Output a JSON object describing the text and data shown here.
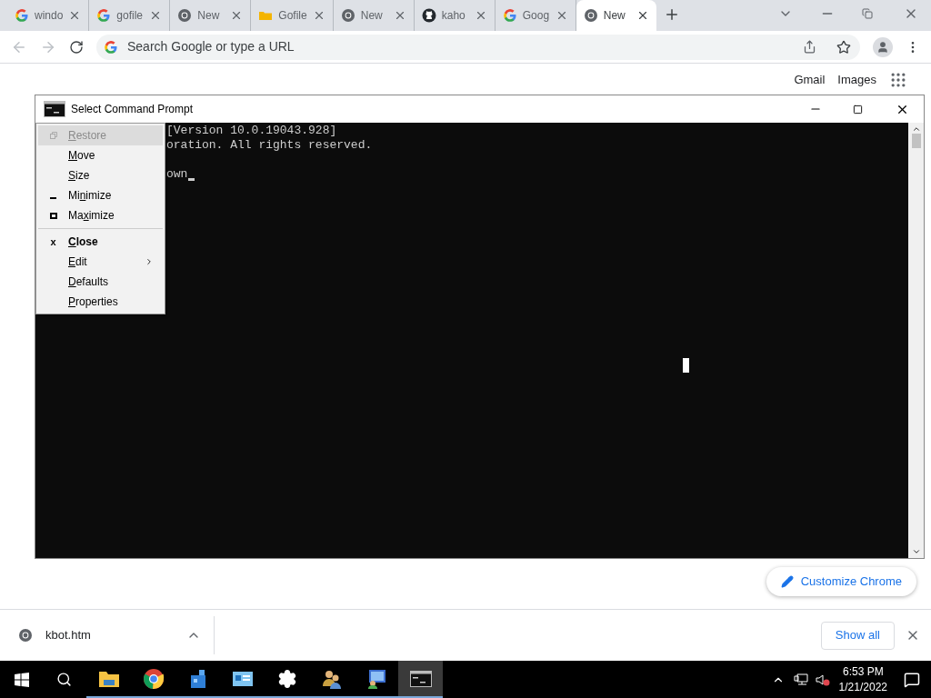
{
  "tabs": [
    {
      "title": "windo",
      "kind": "google",
      "selected": false
    },
    {
      "title": "gofile",
      "kind": "google",
      "selected": false
    },
    {
      "title": "New",
      "kind": "chrome",
      "selected": false
    },
    {
      "title": "Gofile",
      "kind": "folder",
      "selected": false
    },
    {
      "title": "New",
      "kind": "chrome",
      "selected": false
    },
    {
      "title": "kaho",
      "kind": "github",
      "selected": false
    },
    {
      "title": "Goog",
      "kind": "google",
      "selected": false
    },
    {
      "title": "New",
      "kind": "chrome",
      "selected": true
    }
  ],
  "omnibox": {
    "placeholder": "Search Google or type a URL"
  },
  "page_links": [
    "Gmail",
    "Images"
  ],
  "customize_button": "Customize Chrome",
  "console_window": {
    "title": "Select Command Prompt",
    "lines": [
      "[Version 10.0.19043.928]",
      "oration. All rights reserved."
    ],
    "prompt": "own",
    "menu": [
      {
        "hotkey": "R",
        "after": "estore",
        "kind": "restore",
        "disabled": true,
        "selected": true
      },
      {
        "hotkey": "M",
        "after": "ove",
        "kind": "plain",
        "disabled": false,
        "selected": false
      },
      {
        "hotkey": "S",
        "after": "ize",
        "kind": "plain",
        "disabled": false,
        "selected": false
      },
      {
        "before": "Mi",
        "hotkey": "n",
        "after": "imize",
        "kind": "minimize",
        "disabled": false,
        "selected": false
      },
      {
        "before": "Ma",
        "hotkey": "x",
        "after": "imize",
        "kind": "maximize",
        "disabled": false,
        "selected": false
      },
      {
        "hotkey": "C",
        "after": "lose",
        "kind": "default",
        "mark": "x",
        "disabled": false,
        "selected": false
      },
      {
        "hotkey": "E",
        "after": "dit",
        "kind": "submenu",
        "disabled": false,
        "selected": false
      },
      {
        "hotkey": "D",
        "after": "efaults",
        "kind": "plain",
        "disabled": false,
        "selected": false
      },
      {
        "hotkey": "P",
        "after": "roperties",
        "kind": "plain",
        "disabled": false,
        "selected": false
      }
    ]
  },
  "download_bar": {
    "file": "kbot.htm",
    "show_all": "Show all"
  },
  "taskbar": {
    "apps": [
      {
        "kind": "folder",
        "selected": false
      },
      {
        "kind": "chrome",
        "selected": false
      },
      {
        "kind": "cube",
        "selected": false
      },
      {
        "kind": "card",
        "selected": false
      },
      {
        "kind": "gear",
        "selected": false
      },
      {
        "kind": "people",
        "selected": false
      },
      {
        "kind": "monitor",
        "selected": false
      },
      {
        "kind": "console",
        "selected": true
      }
    ],
    "time": "6:53 PM",
    "date": "1/21/2022"
  }
}
